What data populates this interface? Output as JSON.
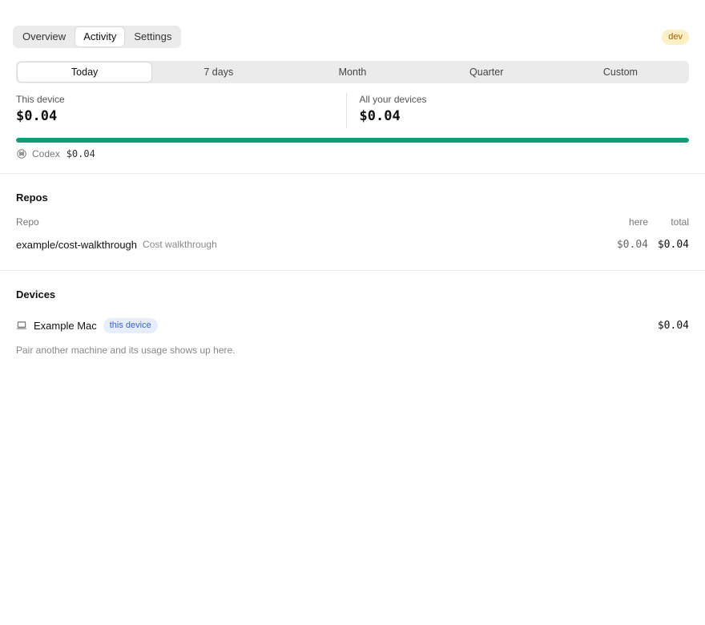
{
  "nav": {
    "tabs": [
      {
        "label": "Overview",
        "active": false
      },
      {
        "label": "Activity",
        "active": true
      },
      {
        "label": "Settings",
        "active": false
      }
    ],
    "env_badge": "dev"
  },
  "range": {
    "options": [
      "Today",
      "7 days",
      "Month",
      "Quarter",
      "Custom"
    ],
    "selected": "Today"
  },
  "stats": {
    "this_device_label": "This device",
    "this_device_value": "$0.04",
    "all_devices_label": "All your devices",
    "all_devices_value": "$0.04"
  },
  "progress": {
    "fraction": 1.0,
    "color": "#129b74"
  },
  "source": {
    "icon": "openai-icon",
    "name": "Codex",
    "cost": "$0.04"
  },
  "repos": {
    "title": "Repos",
    "headers": {
      "repo": "Repo",
      "here": "here",
      "total": "total"
    },
    "rows": [
      {
        "name": "example/cost-walkthrough",
        "description": "Cost walkthrough",
        "here": "$0.04",
        "total": "$0.04"
      }
    ]
  },
  "devices": {
    "title": "Devices",
    "rows": [
      {
        "icon": "laptop-icon",
        "name": "Example Mac",
        "badge": "this device",
        "cost": "$0.04"
      }
    ],
    "hint": "Pair another machine and its usage shows up here."
  },
  "colors": {
    "accent": "#129b74",
    "badge_dev_bg": "#fdf0c4",
    "badge_dev_fg": "#a0600a",
    "badge_device_bg": "#e7eefb",
    "badge_device_fg": "#3b63c9"
  }
}
